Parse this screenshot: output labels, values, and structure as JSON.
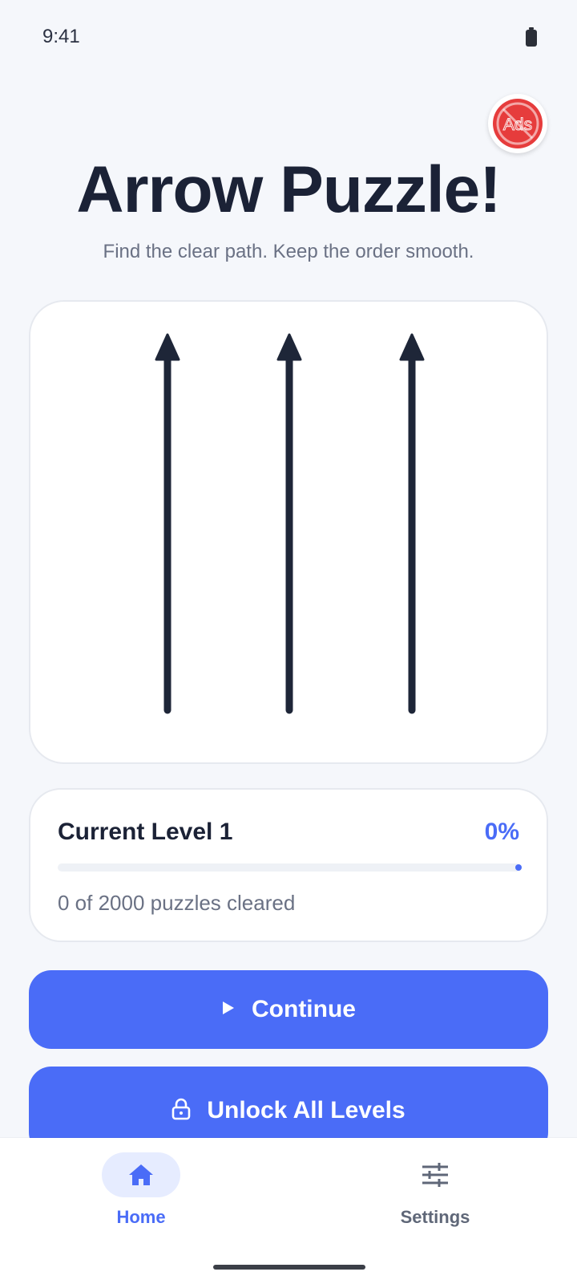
{
  "status_bar": {
    "time": "9:41"
  },
  "badge": {
    "label": "Ads",
    "accent": "#e63c3c"
  },
  "header": {
    "title": "Arrow Puzzle!",
    "subtitle": "Find the clear path. Keep the order smooth."
  },
  "board": {
    "arrows": [
      "up",
      "up",
      "up"
    ]
  },
  "level": {
    "label": "Current Level 1",
    "percent_text": "0%",
    "progress": 0,
    "cleared_text": "0 of 2000 puzzles cleared"
  },
  "buttons": {
    "continue_label": "Continue",
    "continue_icon": "play-icon",
    "unlock_label": "Unlock All Levels",
    "unlock_icon": "lock-icon"
  },
  "nav": {
    "home_label": "Home",
    "home_icon": "home-icon",
    "settings_label": "Settings",
    "settings_icon": "sliders-icon"
  },
  "colors": {
    "accent": "#4a6cf7",
    "background": "#f5f7fb",
    "text_dark": "#1b2236",
    "text_muted": "#6a7184"
  }
}
